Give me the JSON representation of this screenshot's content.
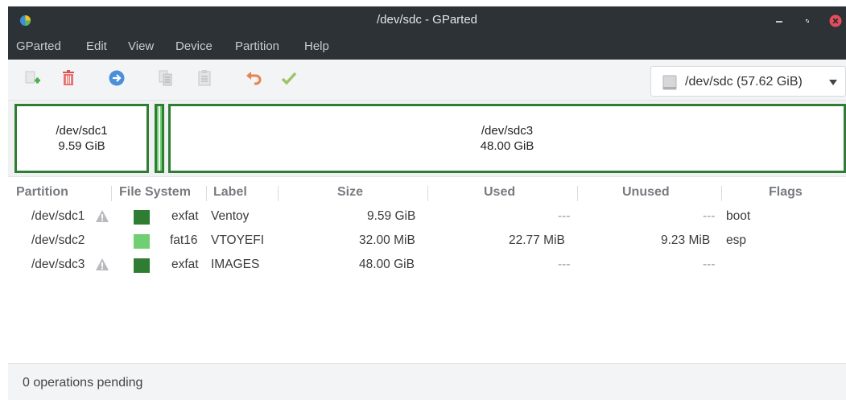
{
  "window": {
    "title": "/dev/sdc - GParted"
  },
  "menu": [
    "GParted",
    "Edit",
    "View",
    "Device",
    "Partition",
    "Help"
  ],
  "toolbar": {
    "icons": [
      "new-partition-icon",
      "delete-partition-icon",
      "resize-move-icon",
      "copy-icon",
      "paste-icon",
      "undo-icon",
      "apply-icon"
    ],
    "device": "/dev/sdc (57.62 GiB)"
  },
  "diskmap": [
    {
      "name": "/dev/sdc1",
      "size": "9.59 GiB"
    },
    {
      "name": "/dev/sdc2",
      "size": ""
    },
    {
      "name": "/dev/sdc3",
      "size": "48.00 GiB"
    }
  ],
  "table": {
    "headers": [
      "Partition",
      "File System",
      "Label",
      "Size",
      "Used",
      "Unused",
      "Flags"
    ],
    "rows": [
      {
        "partition": "/dev/sdc1",
        "warning": true,
        "fs_color": "#2e7d32",
        "filesystem": "exfat",
        "label": "Ventoy",
        "size": "9.59 GiB",
        "used": "---",
        "unused": "---",
        "flags": "boot"
      },
      {
        "partition": "/dev/sdc2",
        "warning": false,
        "fs_color": "#6fcf72",
        "filesystem": "fat16",
        "label": "VTOYEFI",
        "size": "32.00 MiB",
        "used": "22.77 MiB",
        "unused": "9.23 MiB",
        "flags": "esp"
      },
      {
        "partition": "/dev/sdc3",
        "warning": true,
        "fs_color": "#2e7d32",
        "filesystem": "exfat",
        "label": "IMAGES",
        "size": "48.00 GiB",
        "used": "---",
        "unused": "---",
        "flags": ""
      }
    ]
  },
  "status": "0 operations pending",
  "colors": {
    "titlebar": "#2d3236",
    "partition_border": "#2e7d32",
    "exfat": "#2e7d32",
    "fat16": "#6fcf72",
    "close": "#e74c5b"
  }
}
